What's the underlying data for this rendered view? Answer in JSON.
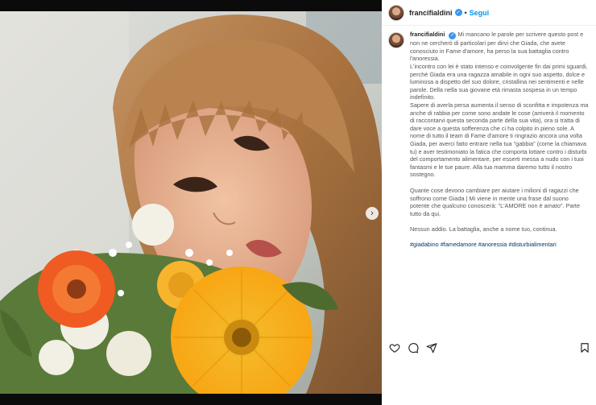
{
  "post": {
    "username": "francifialdini",
    "follow_label": "Segui",
    "separator": "•",
    "verified_mark": "✓",
    "next_arrow": "›",
    "caption": {
      "username": "francifialdini",
      "p1": "Mi mancano le parole per scrivere questo post e non ne cercherò di particolari per dirvi che Giada, che avete conosciuto in Fame d'amore, ha perso la sua battaglia contro l'anoressia.",
      "p2": "L'incontro con lei è stato intenso e coinvolgente fin dai primi sguardi, perché Giada era una ragazza amabile in ogni suo aspetto, dolce e luminosa a dispetto del suo dolore, cristallina nei sentimenti e nelle parole. Della nella sua giovane età rimasta sospesa in un tempo indefinito.",
      "p3": "Sapere di averla persa aumenta il senso di sconfitta e impotenza ma anche di rabbia per come sono andate le cose (arriverà il momento di raccontarvi questa seconda parte della sua vita), ora si tratta di dare voce a questa sofferenza che ci ha colpito in pieno sole. A nome di tutto il team di Fame d'amore ti ringrazio ancora una volta Giada, per averci fatto entrare nella tua \"gabbia\" (come la chiamava tu) e aver testimoniato la fatica che comporta lottare contro i disturbi del comportamento alimentare, per esserti messa a nudo con i tuoi fantasmi e le tue paure. Alla tua mamma daremo tutto il nostro sostegno.",
      "p4": "Quante cose devono cambiare per aiutare i milioni di ragazzi che soffrono come Giada | Mi viene in mente una frase dal suono potente che qualcuno conoscerà: \"L'AMORE non è amato\". Parte tutto da qui.",
      "p5": "Nessun addio. La battaglia, anche a nome tuo, continua.",
      "hashtags": "#giadabino #famedamore #anoressia #disturbialimentari"
    }
  },
  "icons": [
    "heart-icon",
    "comment-icon",
    "share-icon",
    "bookmark-icon",
    "verified-icon",
    "chevron-right-icon"
  ],
  "colors": {
    "accent": "#0095f6",
    "verified": "#3897f0",
    "hashtag": "#00376b",
    "text": "#262626"
  }
}
